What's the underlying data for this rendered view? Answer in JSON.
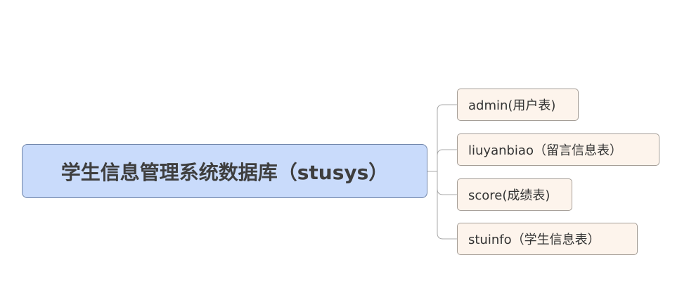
{
  "colors": {
    "root_fill": "#c9dbfb",
    "root_border": "#6f84a8",
    "child_fill": "#fdf4ec",
    "child_border": "#a59e97",
    "connector": "#a8a8a8"
  },
  "mindmap": {
    "root": {
      "label": "学生信息管理系统数据库（stusys）"
    },
    "children": [
      {
        "label": "admin(用户表)"
      },
      {
        "label": "liuyanbiao（留言信息表）"
      },
      {
        "label": "score(成绩表)"
      },
      {
        "label": "stuinfo（学生信息表）"
      }
    ]
  }
}
